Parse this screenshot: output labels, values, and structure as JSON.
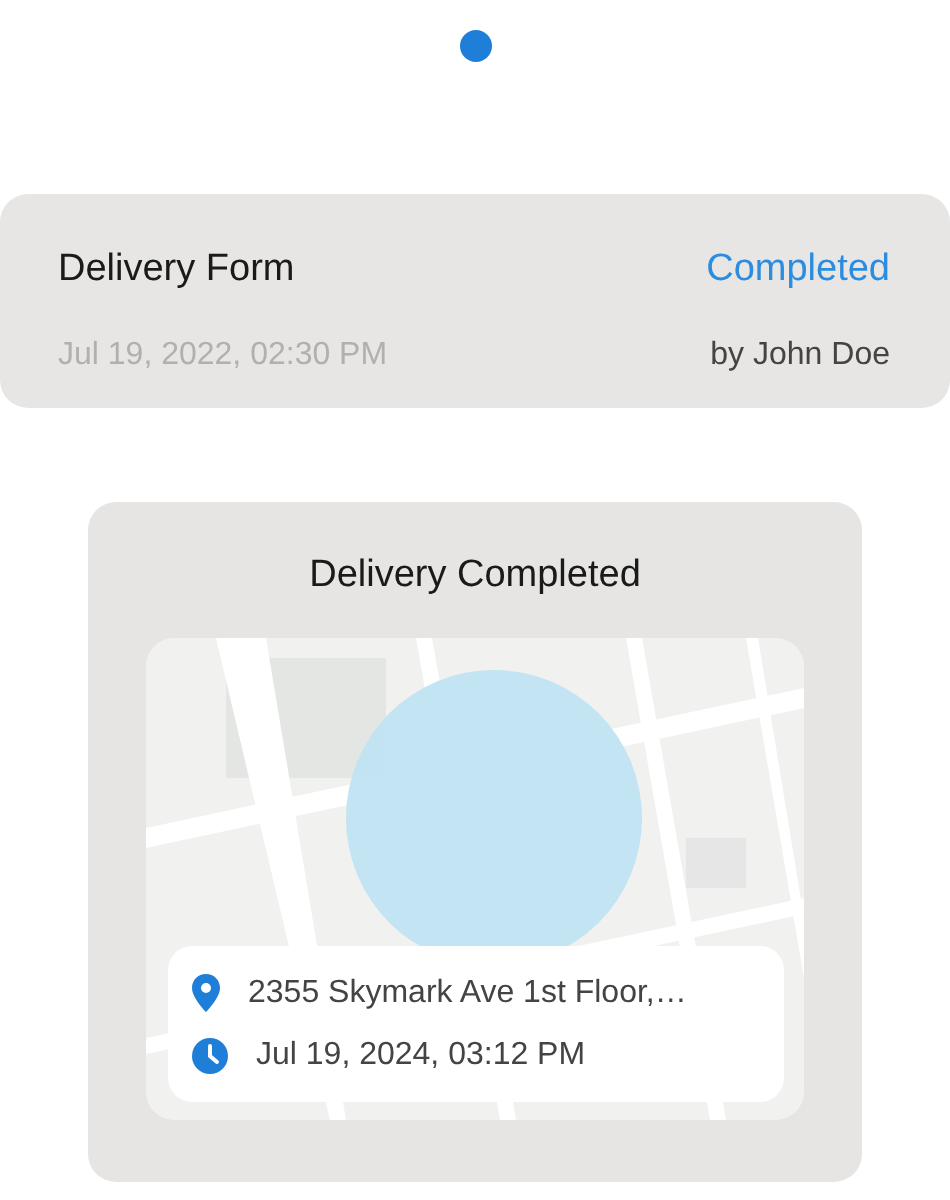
{
  "page_indicator": {
    "kind": "dot"
  },
  "form": {
    "title": "Delivery Form",
    "timestamp": "Jul 19, 2022, 02:30 PM",
    "status": {
      "label": "Completed",
      "kind": "completed"
    },
    "author": "by John Doe"
  },
  "delivery": {
    "title": "Delivery Completed",
    "details": [
      {
        "kind": "location",
        "text": "2355 Skymark Ave 1st Floor,…"
      },
      {
        "kind": "time",
        "text": "Jul 19, 2024, 03:12 PM"
      }
    ]
  }
}
